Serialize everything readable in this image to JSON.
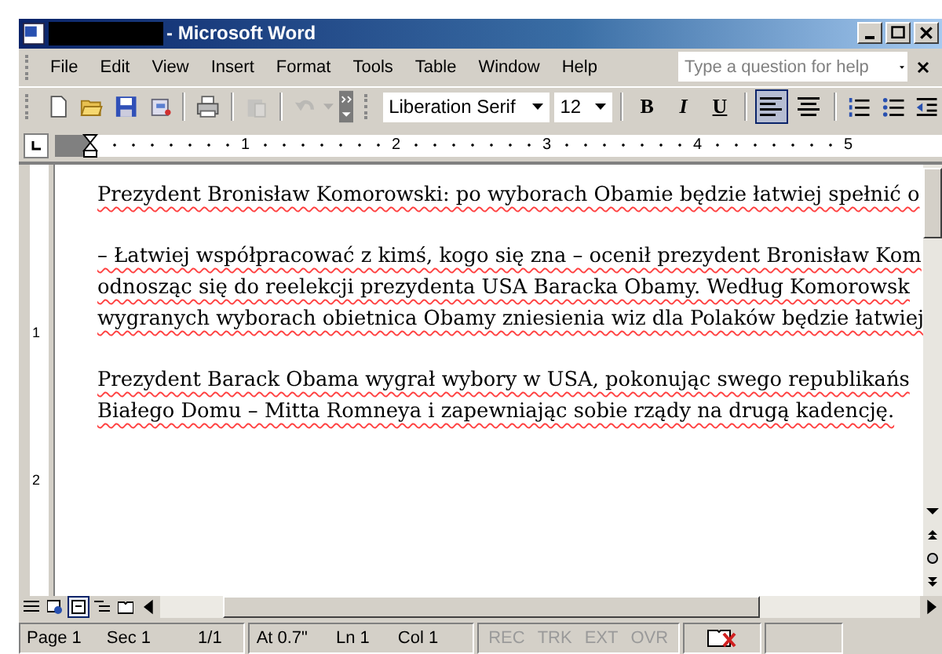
{
  "window": {
    "title": "- Microsoft Word"
  },
  "menu": [
    "File",
    "Edit",
    "View",
    "Insert",
    "Format",
    "Tools",
    "Table",
    "Window",
    "Help"
  ],
  "help_search": {
    "placeholder": "Type a question for help"
  },
  "toolbar": {
    "font": "Liberation Serif",
    "size": "12",
    "format_buttons": [
      {
        "label": "B",
        "kind": "bold"
      },
      {
        "label": "I",
        "kind": "italic"
      },
      {
        "label": "U",
        "kind": "underline"
      }
    ],
    "align_buttons": [
      {
        "kind": "left",
        "selected": true
      },
      {
        "kind": "center",
        "selected": false
      }
    ]
  },
  "ruler": {
    "marks": [
      "1",
      "2",
      "3",
      "4",
      "5"
    ],
    "vertical_marks": [
      "1",
      "2"
    ]
  },
  "document": {
    "paragraphs": [
      [
        "Prezydent Bronisław Komorowski: po wyborach Obamie będzie łatwiej spełnić o"
      ],
      [
        "– Łatwiej współpracować z kimś, kogo się zna – ocenił prezydent Bronisław Kom",
        "odnosząc się do reelekcji prezydenta USA Baracka Obamy. Według Komorowsk",
        "wygranych wyborach obietnica Obamy zniesienia wiz dla Polaków będzie łatwiej"
      ],
      [
        " Prezydent Barack Obama wygrał wybory w USA, pokonując swego republikańs",
        "Białego Domu – Mitta Romneya i zapewniając sobie rządy na drugą kadencję."
      ]
    ]
  },
  "views": [
    {
      "kind": "normal",
      "selected": false
    },
    {
      "kind": "web",
      "selected": false
    },
    {
      "kind": "print",
      "selected": true
    },
    {
      "kind": "outline",
      "selected": false
    },
    {
      "kind": "reading",
      "selected": false
    }
  ],
  "status_bar": {
    "fields": [
      "Page 1",
      "Sec 1",
      "1/1",
      "At 0.7\"",
      "Ln 1",
      "Col 1"
    ],
    "indicators": [
      {
        "label": "REC",
        "disabled": true
      },
      {
        "label": "TRK",
        "disabled": true
      },
      {
        "label": "EXT",
        "disabled": true
      },
      {
        "label": "OVR",
        "disabled": true
      }
    ]
  }
}
